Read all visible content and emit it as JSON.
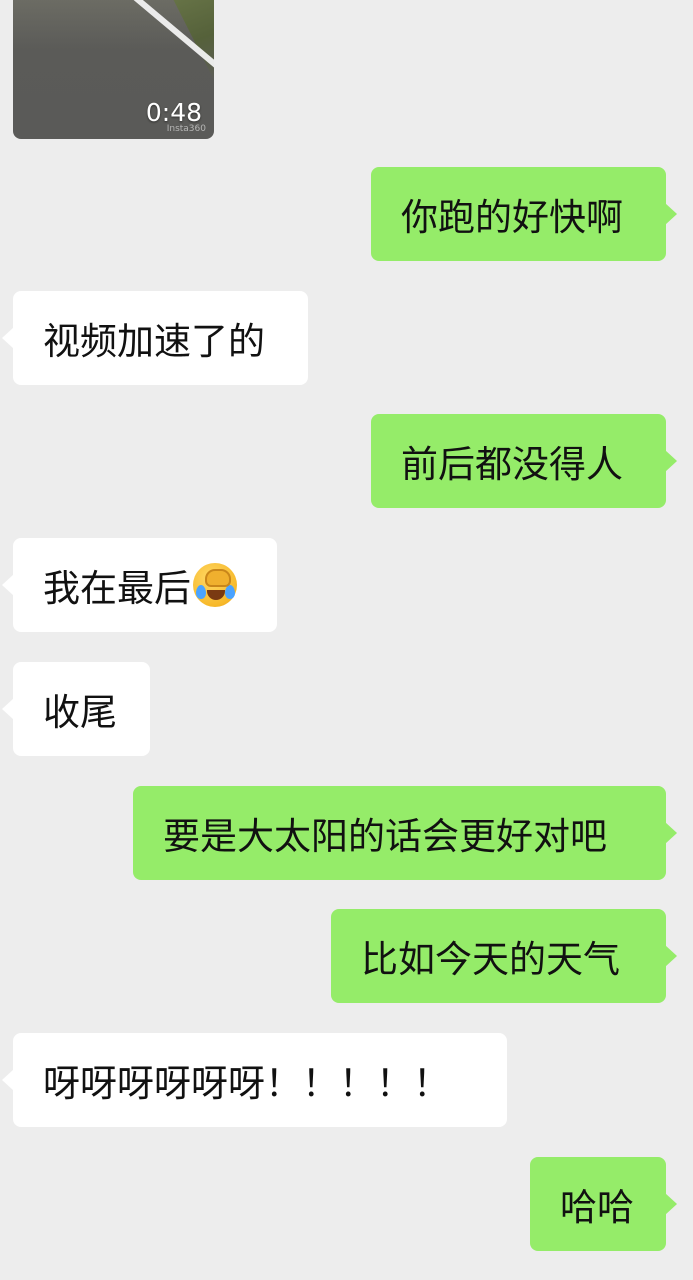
{
  "video": {
    "duration": "0:48",
    "watermark": "Insta360"
  },
  "messages": [
    {
      "side": "out",
      "text": "你跑的好快啊"
    },
    {
      "side": "in",
      "text": "视频加速了的"
    },
    {
      "side": "out",
      "text": "前后都没得人"
    },
    {
      "side": "in",
      "text": "我在最后",
      "emoji": "face-with-tears-of-joy-hand-emoji"
    },
    {
      "side": "in",
      "text": "收尾"
    },
    {
      "side": "out",
      "text": "要是大太阳的话会更好对吧"
    },
    {
      "side": "out",
      "text": "比如今天的天气"
    },
    {
      "side": "in",
      "text": "呀呀呀呀呀呀！！！！！"
    },
    {
      "side": "out",
      "text": "哈哈"
    }
  ],
  "colors": {
    "background": "#ededed",
    "outgoing_bubble": "#95ec69",
    "incoming_bubble": "#ffffff"
  }
}
